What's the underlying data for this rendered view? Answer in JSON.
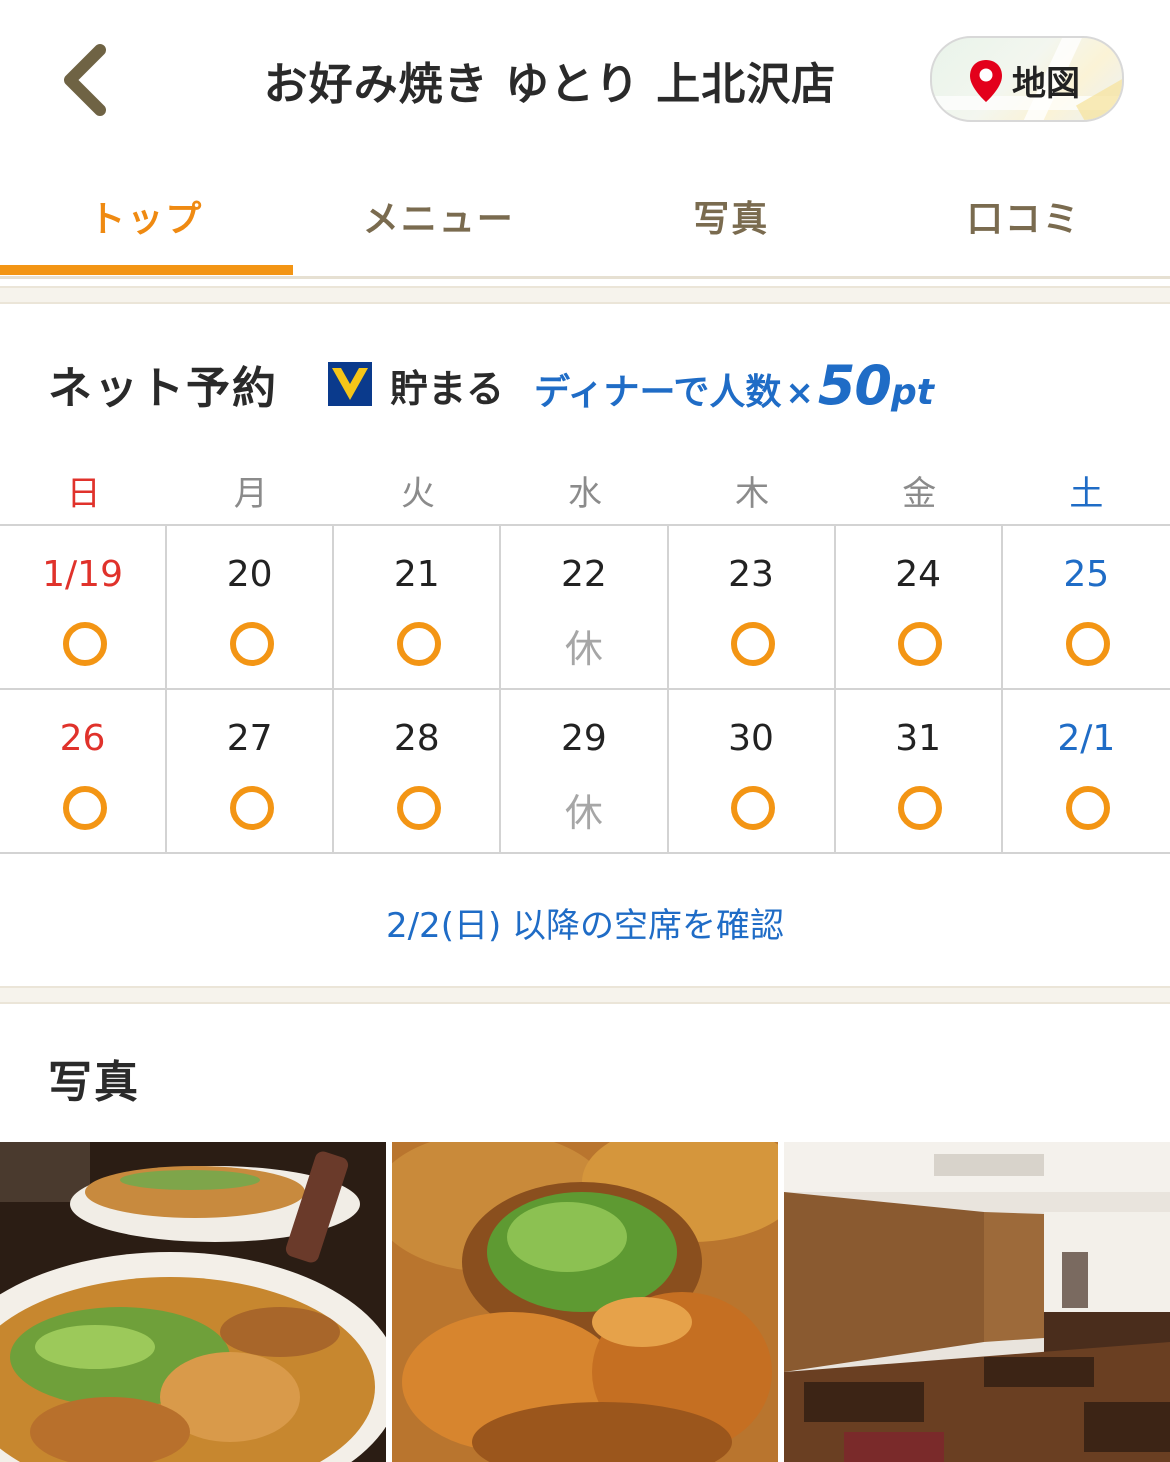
{
  "header": {
    "title": "お好み焼き ゆとり 上北沢店",
    "map_label": "地図"
  },
  "tabs": [
    {
      "label": "トップ",
      "active": true
    },
    {
      "label": "メニュー",
      "active": false
    },
    {
      "label": "写真",
      "active": false
    },
    {
      "label": "口コミ",
      "active": false
    }
  ],
  "reservation": {
    "title": "ネット予約",
    "points_brand": "貯まる",
    "promo_text": "ディナーで人数",
    "promo_x": "×",
    "promo_points": "50",
    "promo_unit": "pt",
    "weekdays": [
      "日",
      "月",
      "火",
      "水",
      "木",
      "金",
      "土"
    ],
    "weeks": [
      [
        {
          "date": "1/19",
          "status": "open"
        },
        {
          "date": "20",
          "status": "open"
        },
        {
          "date": "21",
          "status": "open"
        },
        {
          "date": "22",
          "status": "closed",
          "label": "休"
        },
        {
          "date": "23",
          "status": "open"
        },
        {
          "date": "24",
          "status": "open"
        },
        {
          "date": "25",
          "status": "open"
        }
      ],
      [
        {
          "date": "26",
          "status": "open"
        },
        {
          "date": "27",
          "status": "open"
        },
        {
          "date": "28",
          "status": "open"
        },
        {
          "date": "29",
          "status": "closed",
          "label": "休"
        },
        {
          "date": "30",
          "status": "open"
        },
        {
          "date": "31",
          "status": "open"
        },
        {
          "date": "2/1",
          "status": "open"
        }
      ]
    ],
    "more_link": "2/2(日) 以降の空席を確認"
  },
  "photos": {
    "title": "写真"
  },
  "colors": {
    "accent": "#f39514",
    "sunday": "#e0322b",
    "saturday": "#1f6cc6",
    "link": "#1f6cc6"
  }
}
